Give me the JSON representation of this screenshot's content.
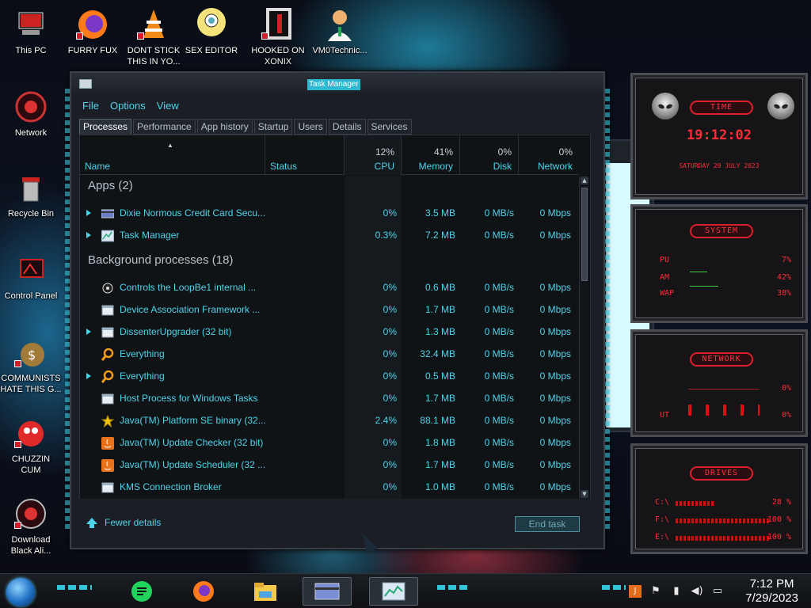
{
  "desktop": {
    "icons": [
      {
        "id": "this-pc",
        "label": "This PC"
      },
      {
        "id": "furry-fux",
        "label": "FURRY FUX"
      },
      {
        "id": "dont-stick",
        "label": "DONT STICK\nTHIS IN YO..."
      },
      {
        "id": "sex-editor",
        "label": "SEX EDITOR"
      },
      {
        "id": "hooked-on-xonix",
        "label": "HOOKED ON\nXONIX"
      },
      {
        "id": "vm0technic",
        "label": "VM0Technic..."
      },
      {
        "id": "network",
        "label": "Network"
      },
      {
        "id": "recycle-bin",
        "label": "Recycle Bin"
      },
      {
        "id": "control-panel",
        "label": "Control Panel"
      },
      {
        "id": "communists",
        "label": "COMMUNISTS\nHATE THIS G..."
      },
      {
        "id": "chuzzin-cum",
        "label": "CHUZZIN\nCUM"
      },
      {
        "id": "download-black",
        "label": "Download\nBlack Ali..."
      }
    ]
  },
  "task_manager": {
    "title": "Task Manager",
    "menu": [
      "File",
      "Options",
      "View"
    ],
    "tabs": [
      "Processes",
      "Performance",
      "App history",
      "Startup",
      "Users",
      "Details",
      "Services"
    ],
    "active_tab": "Processes",
    "columns": {
      "name": "Name",
      "status": "Status",
      "cpu": {
        "pct": "12%",
        "label": "CPU"
      },
      "memory": {
        "pct": "41%",
        "label": "Memory"
      },
      "disk": {
        "pct": "0%",
        "label": "Disk"
      },
      "network": {
        "pct": "0%",
        "label": "Network"
      }
    },
    "groups": {
      "apps": "Apps (2)",
      "background": "Background processes (18)"
    },
    "apps": [
      {
        "name": "Dixie Normous Credit Card Secu...",
        "cpu": "0%",
        "memory": "3.5 MB",
        "disk": "0 MB/s",
        "network": "0 Mbps",
        "expandable": true,
        "icon": "credit-card-icon"
      },
      {
        "name": "Task Manager",
        "cpu": "0.3%",
        "memory": "7.2 MB",
        "disk": "0 MB/s",
        "network": "0 Mbps",
        "expandable": true,
        "icon": "task-manager-icon"
      }
    ],
    "background": [
      {
        "name": "Controls the LoopBe1 internal ...",
        "cpu": "0%",
        "memory": "0.6 MB",
        "disk": "0 MB/s",
        "network": "0 Mbps",
        "expandable": false,
        "icon": "loopbe-icon"
      },
      {
        "name": "Device Association Framework ...",
        "cpu": "0%",
        "memory": "1.7 MB",
        "disk": "0 MB/s",
        "network": "0 Mbps",
        "expandable": false,
        "icon": "window-icon"
      },
      {
        "name": "DissenterUpgrader (32 bit)",
        "cpu": "0%",
        "memory": "1.3 MB",
        "disk": "0 MB/s",
        "network": "0 Mbps",
        "expandable": true,
        "icon": "window-icon"
      },
      {
        "name": "Everything",
        "cpu": "0%",
        "memory": "32.4 MB",
        "disk": "0 MB/s",
        "network": "0 Mbps",
        "expandable": false,
        "icon": "magnifier-icon"
      },
      {
        "name": "Everything",
        "cpu": "0%",
        "memory": "0.5 MB",
        "disk": "0 MB/s",
        "network": "0 Mbps",
        "expandable": true,
        "icon": "magnifier-icon"
      },
      {
        "name": "Host Process for Windows Tasks",
        "cpu": "0%",
        "memory": "1.7 MB",
        "disk": "0 MB/s",
        "network": "0 Mbps",
        "expandable": false,
        "icon": "window-icon"
      },
      {
        "name": "Java(TM) Platform SE binary (32...",
        "cpu": "2.4%",
        "memory": "88.1 MB",
        "disk": "0 MB/s",
        "network": "0 Mbps",
        "expandable": false,
        "icon": "star-icon"
      },
      {
        "name": "Java(TM) Update Checker (32 bit)",
        "cpu": "0%",
        "memory": "1.8 MB",
        "disk": "0 MB/s",
        "network": "0 Mbps",
        "expandable": false,
        "icon": "java-icon"
      },
      {
        "name": "Java(TM) Update Scheduler (32 ...",
        "cpu": "0%",
        "memory": "1.7 MB",
        "disk": "0 MB/s",
        "network": "0 Mbps",
        "expandable": false,
        "icon": "java-icon"
      },
      {
        "name": "KMS Connection Broker",
        "cpu": "0%",
        "memory": "1.0 MB",
        "disk": "0 MB/s",
        "network": "0 Mbps",
        "expandable": false,
        "icon": "window-icon"
      }
    ],
    "fewer_details": "Fewer details",
    "end_task": "End task"
  },
  "gadgets": {
    "time": {
      "title": "TIME",
      "time": "19:12:02",
      "date": "SATURDAY 29 JULY 2023"
    },
    "system": {
      "title": "SYSTEM",
      "cpu_label": "PU",
      "cpu_val": "7%",
      "ram_label": "AM",
      "ram_val": "42%",
      "swap_label": "WAP",
      "swap_val": "38%"
    },
    "network": {
      "title": "NETWORK",
      "in_val": "0%",
      "out_label": "UT",
      "out_val": "0%"
    },
    "drives": {
      "title": "DRIVES",
      "c_label": "C:\\",
      "c_val": "28 %",
      "f_label": "F:\\",
      "f_val": "100 %",
      "e_label": "E:\\",
      "e_val": "100 %"
    }
  },
  "taskbar": {
    "time": "7:12 PM",
    "date": "7/29/2023"
  },
  "colors": {
    "accent": "#4fd3ea",
    "gadget_red": "#ff2a38",
    "window_bg": "#1b1f25"
  }
}
